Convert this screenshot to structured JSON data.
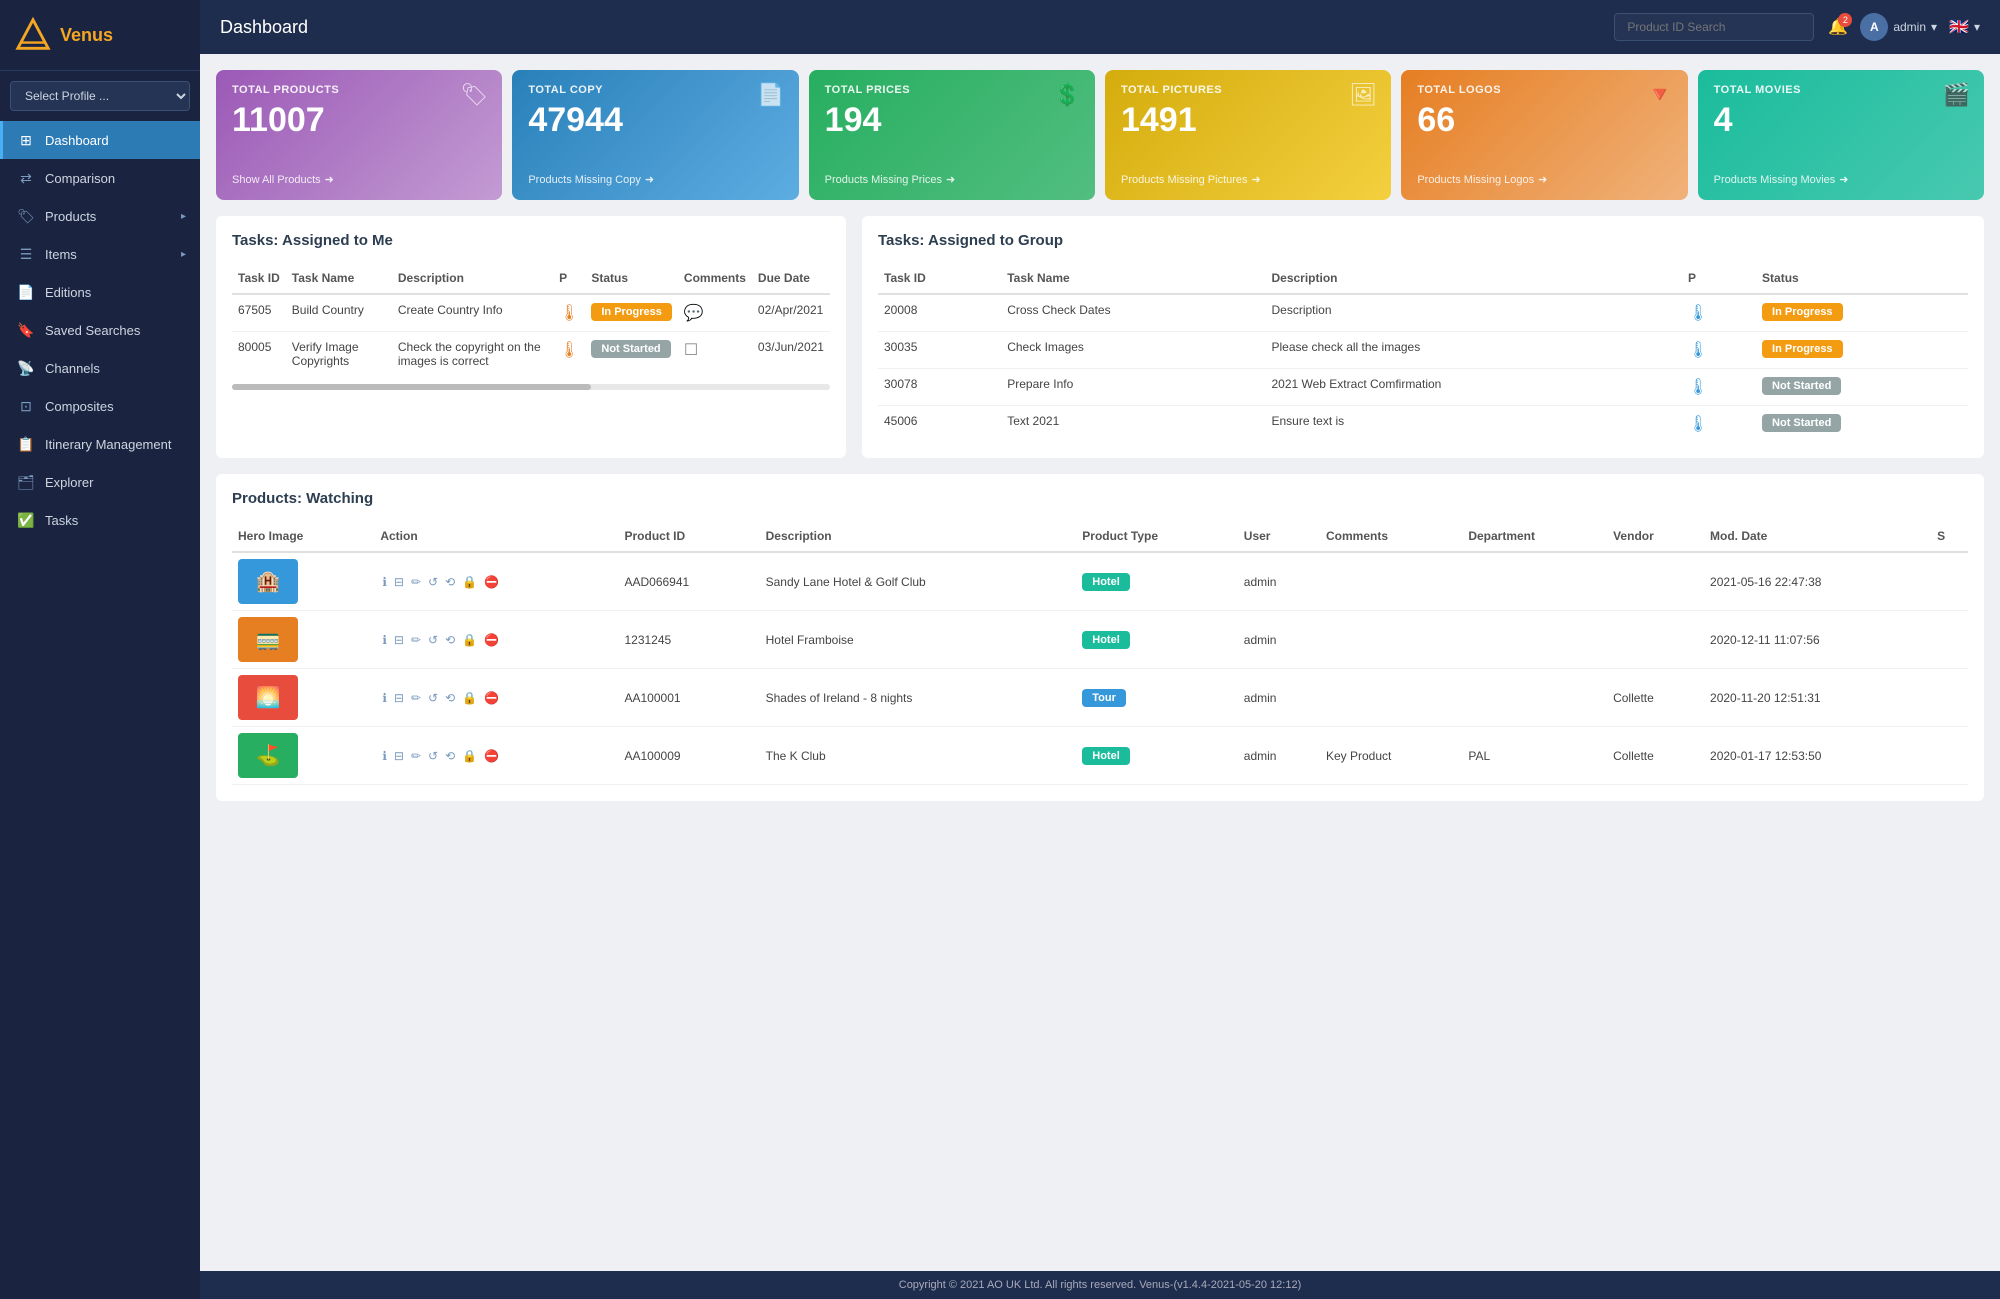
{
  "app": {
    "name": "Venus",
    "title": "Dashboard",
    "footer": "Copyright © 2021 AO UK Ltd. All rights reserved. Venus-(v1.4.4-2021-05-20 12:12)"
  },
  "topbar": {
    "search_placeholder": "Product ID Search",
    "notif_count": "2",
    "admin_label": "admin",
    "flag": "🇬🇧"
  },
  "sidebar": {
    "profile_placeholder": "Select Profile ...",
    "items": [
      {
        "id": "dashboard",
        "label": "Dashboard",
        "icon": "⊞",
        "active": true
      },
      {
        "id": "comparison",
        "label": "Comparison",
        "icon": "⇄",
        "active": false
      },
      {
        "id": "products",
        "label": "Products",
        "icon": "🏷",
        "active": false,
        "has_arrow": true
      },
      {
        "id": "items",
        "label": "Items",
        "icon": "☰",
        "active": false,
        "has_arrow": true
      },
      {
        "id": "editions",
        "label": "Editions",
        "icon": "📄",
        "active": false
      },
      {
        "id": "saved-searches",
        "label": "Saved Searches",
        "icon": "🔖",
        "active": false
      },
      {
        "id": "channels",
        "label": "Channels",
        "icon": "📡",
        "active": false
      },
      {
        "id": "composites",
        "label": "Composites",
        "icon": "⊡",
        "active": false
      },
      {
        "id": "itinerary",
        "label": "Itinerary Management",
        "icon": "📋",
        "active": false
      },
      {
        "id": "explorer",
        "label": "Explorer",
        "icon": "🗂",
        "active": false
      },
      {
        "id": "tasks",
        "label": "Tasks",
        "icon": "✅",
        "active": false
      }
    ]
  },
  "stat_cards": [
    {
      "id": "products",
      "label": "TOTAL PRODUCTS",
      "value": "11007",
      "link": "Show All Products",
      "icon": "🏷",
      "color_class": "card-purple"
    },
    {
      "id": "copy",
      "label": "TOTAL COPY",
      "value": "47944",
      "link": "Products Missing Copy",
      "icon": "📄",
      "color_class": "card-blue"
    },
    {
      "id": "prices",
      "label": "TOTAL PRICES",
      "value": "194",
      "link": "Products Missing Prices",
      "icon": "💲",
      "color_class": "card-green"
    },
    {
      "id": "pictures",
      "label": "TOTAL PICTURES",
      "value": "1491",
      "link": "Products Missing Pictures",
      "icon": "🖼",
      "color_class": "card-yellow"
    },
    {
      "id": "logos",
      "label": "TOTAL LOGOS",
      "value": "66",
      "link": "Products Missing Logos",
      "icon": "🔻",
      "color_class": "card-orange"
    },
    {
      "id": "movies",
      "label": "TOTAL MOVIES",
      "value": "4",
      "link": "Products Missing Movies",
      "icon": "🎬",
      "color_class": "card-teal"
    }
  ],
  "tasks_mine": {
    "title": "Tasks: Assigned to Me",
    "columns": [
      "Task ID",
      "Task Name",
      "Description",
      "P",
      "Status",
      "Comments",
      "Due Date"
    ],
    "rows": [
      {
        "task_id": "67505",
        "task_name": "Build Country",
        "description": "Create Country Info",
        "priority": "🌡",
        "status": "In Progress",
        "status_class": "status-inprogress",
        "comments": "💬",
        "due_date": "02/Apr/2021"
      },
      {
        "task_id": "80005",
        "task_name": "Verify Image Copyrights",
        "description": "Check the copyright on the images is correct",
        "priority": "🌡",
        "status": "Not Started",
        "status_class": "status-notstarted",
        "comments": "☐",
        "due_date": "03/Jun/2021"
      }
    ]
  },
  "tasks_group": {
    "title": "Tasks: Assigned to Group",
    "columns": [
      "Task ID",
      "Task Name",
      "Description",
      "P",
      "Status"
    ],
    "rows": [
      {
        "task_id": "20008",
        "task_name": "Cross Check Dates",
        "description": "Description",
        "priority": "🌡",
        "status": "In Progress",
        "status_class": "status-inprogress"
      },
      {
        "task_id": "30035",
        "task_name": "Check Images",
        "description": "Please check all the images",
        "priority": "🌡",
        "status": "In Progress",
        "status_class": "status-inprogress"
      },
      {
        "task_id": "30078",
        "task_name": "Prepare Info",
        "description": "2021 Web Extract Comfirmation",
        "priority": "🌡",
        "status": "Not Started",
        "status_class": "status-notstarted"
      },
      {
        "task_id": "45006",
        "task_name": "Text 2021",
        "description": "Ensure text is",
        "priority": "🌡",
        "status": "Not Started",
        "status_class": "status-notstarted"
      }
    ]
  },
  "products_watching": {
    "title": "Products: Watching",
    "columns": [
      "Hero Image",
      "Action",
      "Product ID",
      "Description",
      "Product Type",
      "User",
      "Comments",
      "Department",
      "Vendor",
      "Mod. Date",
      "S"
    ],
    "rows": [
      {
        "product_id": "AAD066941",
        "description": "Sandy Lane Hotel & Golf Club",
        "type": "Hotel",
        "type_class": "type-hotel",
        "user": "admin",
        "comments": "",
        "department": "",
        "vendor": "",
        "mod_date": "2021-05-16 22:47:38",
        "color": "#3498db"
      },
      {
        "product_id": "1231245",
        "description": "Hotel Framboise",
        "type": "Hotel",
        "type_class": "type-hotel",
        "user": "admin",
        "comments": "",
        "department": "",
        "vendor": "",
        "mod_date": "2020-12-11 11:07:56",
        "color": "#e67e22"
      },
      {
        "product_id": "AA100001",
        "description": "Shades of Ireland - 8 nights",
        "type": "Tour",
        "type_class": "type-tour",
        "user": "admin",
        "comments": "",
        "department": "",
        "vendor": "Collette",
        "mod_date": "2020-11-20 12:51:31",
        "color": "#e74c3c"
      },
      {
        "product_id": "AA100009",
        "description": "The K Club",
        "type": "Hotel",
        "type_class": "type-hotel",
        "user": "admin",
        "comments": "Key Product",
        "department": "PAL",
        "vendor": "Collette",
        "mod_date": "2020-01-17 12:53:50",
        "color": "#27ae60"
      }
    ]
  }
}
